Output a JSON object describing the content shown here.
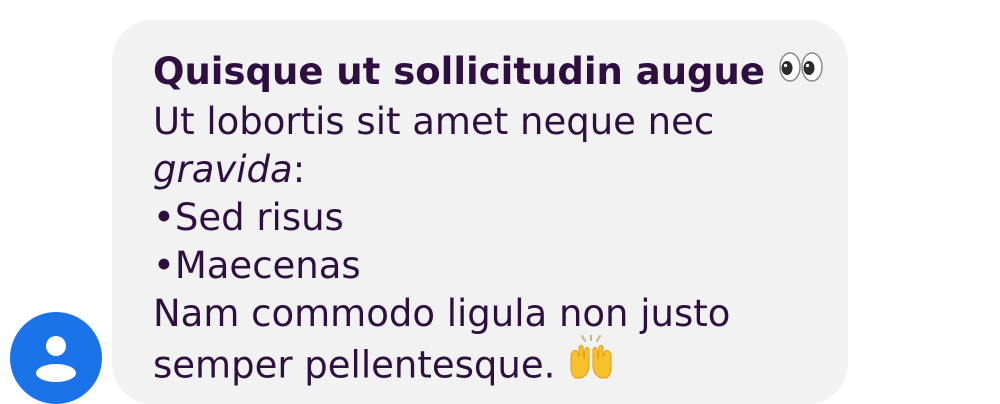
{
  "message": {
    "title": "Quisque ut sollicitudin augue",
    "title_emoji": "eyes-emoji",
    "line2": "Ut lobortis sit amet neque nec",
    "line3_italic": "gravida",
    "line3_tail": ":",
    "bullet_char": "•",
    "bullets": [
      "Sed risus",
      "Maecenas"
    ],
    "line6": "Nam commodo ligula non justo",
    "line7": "semper pellentesque.",
    "end_emoji": "raising-hands-emoji"
  },
  "avatar": {
    "icon": "person-icon",
    "color": "#1a73e8"
  },
  "colors": {
    "text": "#2e0f3f",
    "bubble": "#f2f2f2"
  }
}
